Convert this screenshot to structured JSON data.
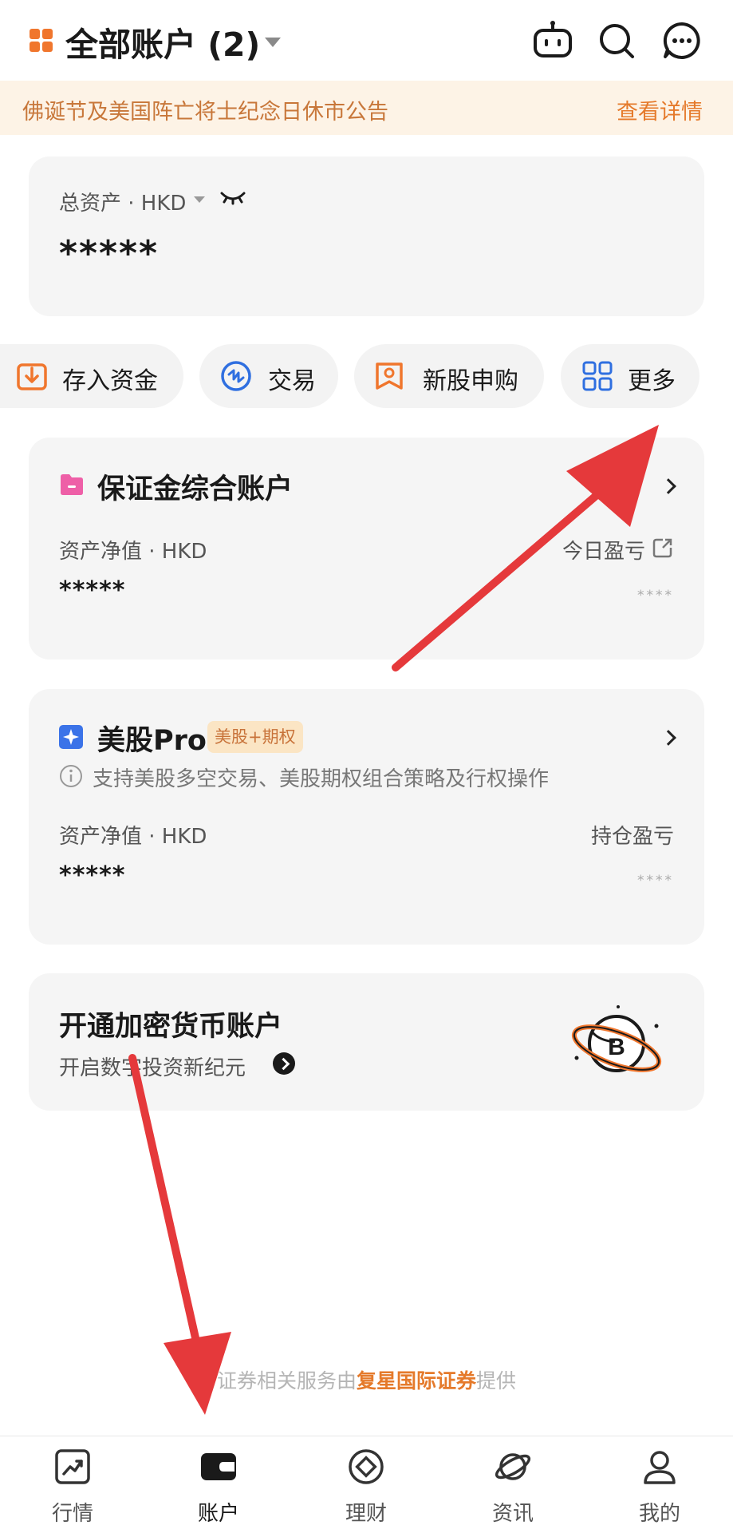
{
  "header": {
    "account_title": "全部账户 (2)",
    "icons": [
      "robot-icon",
      "search-icon",
      "message-icon"
    ]
  },
  "notice": {
    "text": "佛诞节及美国阵亡将士纪念日休市公告",
    "link": "查看详情"
  },
  "total_assets": {
    "label": "总资产 · HKD",
    "value": "*****"
  },
  "actions": [
    {
      "label": "存入资金",
      "icon": "deposit-icon"
    },
    {
      "label": "交易",
      "icon": "trade-icon"
    },
    {
      "label": "新股申购",
      "icon": "ipo-icon"
    },
    {
      "label": "更多",
      "icon": "grid-icon"
    }
  ],
  "margin_account": {
    "title": "保证金综合账户",
    "net_label": "资产净值 · HKD",
    "pnl_label": "今日盈亏",
    "net_value": "*****",
    "pnl_value": "****"
  },
  "us_pro": {
    "title": "美股Pro",
    "badge": "美股+期权",
    "desc": "支持美股多空交易、美股期权组合策略及行权操作",
    "net_label": "资产净值 · HKD",
    "pnl_label": "持仓盈亏",
    "net_value": "*****",
    "pnl_value": "****"
  },
  "crypto": {
    "title": "开通加密货币账户",
    "subtitle": "开启数字投资新纪元"
  },
  "footnote": {
    "prefix": "证券相关服务由",
    "brand": "复星国际证券",
    "suffix": "提供"
  },
  "tabs": [
    {
      "label": "行情",
      "icon": "chart-icon"
    },
    {
      "label": "账户",
      "icon": "wallet-icon",
      "active": true
    },
    {
      "label": "理财",
      "icon": "wealth-icon"
    },
    {
      "label": "资讯",
      "icon": "planet-icon"
    },
    {
      "label": "我的",
      "icon": "profile-icon"
    }
  ],
  "colors": {
    "accent": "#e57a2b",
    "notice_bg": "#fdf3e6",
    "card_bg": "#f5f5f5",
    "annotation_arrow": "#e5393b"
  }
}
